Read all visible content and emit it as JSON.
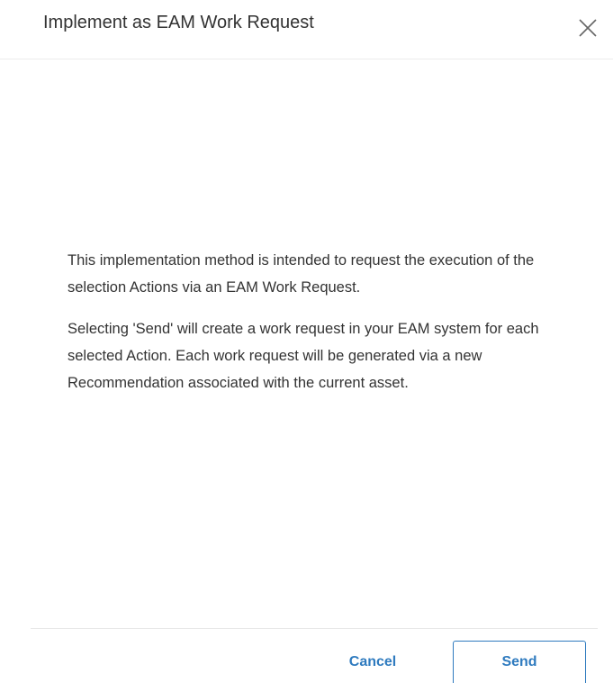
{
  "dialog": {
    "title": "Implement as EAM Work Request",
    "close_icon": "close-icon",
    "paragraphs": [
      "This implementation method is intended to request the execution of the selection Actions via an EAM Work Request.",
      "Selecting 'Send' will create a work request in your EAM system for each selected Action. Each work request will be generated via a new Recommendation associated with the current asset."
    ],
    "buttons": {
      "cancel_label": "Cancel",
      "send_label": "Send"
    },
    "accent_color": "#2f7bbf"
  }
}
